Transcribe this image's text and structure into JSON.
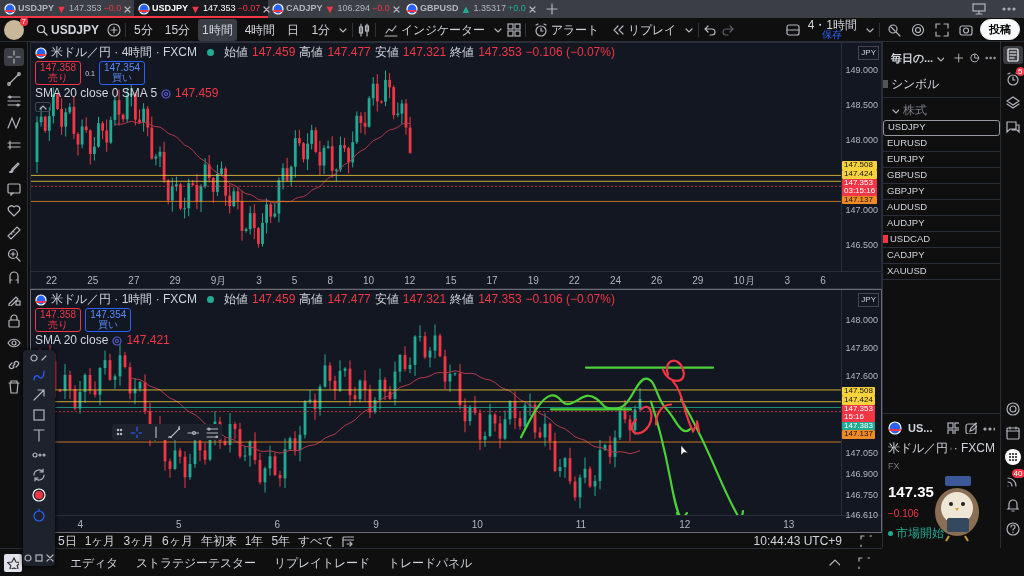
{
  "tabs": [
    {
      "symbol": "USDJPY",
      "arrow": "▼",
      "color": "#f23645",
      "price": "147.353",
      "change": "−0.0",
      "selected": false
    },
    {
      "symbol": "USDJPY",
      "arrow": "▼",
      "color": "#f23645",
      "price": "147.353",
      "change": "−0.07",
      "selected": true
    },
    {
      "symbol": "CADJPY",
      "arrow": "▼",
      "color": "#f23645",
      "price": "106.294",
      "change": "−0.0",
      "selected": false
    },
    {
      "symbol": "GBPUSD",
      "arrow": "▲",
      "color": "#22ab94",
      "price": "1.35317",
      "change": "+0.0",
      "selected": false
    }
  ],
  "toolbar": {
    "badge": "7",
    "symbol": "USDJPY",
    "intervals": [
      {
        "label": "5分",
        "selected": false
      },
      {
        "label": "15分",
        "selected": false
      },
      {
        "label": "1時間",
        "selected": true
      },
      {
        "label": "4時間",
        "selected": false
      },
      {
        "label": "日",
        "selected": false
      },
      {
        "label": "1分",
        "selected": false
      }
    ],
    "indicators": "インジケーター",
    "alert": "アラート",
    "replay": "リプレイ",
    "layout": "4・1時間",
    "layout_status": "保存",
    "post": "投稿"
  },
  "charts": [
    {
      "title": "米ドル／円 · 4時間 · FXCM",
      "ohlc": [
        {
          "label": "始値",
          "value": "147.459"
        },
        {
          "label": "高値",
          "value": "147.477"
        },
        {
          "label": "安値",
          "value": "147.321"
        },
        {
          "label": "終値",
          "value": "147.353"
        }
      ],
      "change": "−0.106 (−0.07%)",
      "sell": {
        "price": "147.358",
        "label": "売り"
      },
      "spread": "0.1",
      "buy": {
        "price": "147.354",
        "label": "買い"
      },
      "sma": "SMA 20 close 0 SMA 5",
      "sma_value": "147.459",
      "currency": "JPY",
      "price_ticks": [
        "149.000",
        "148.500",
        "148.000",
        "147.000",
        "146.500"
      ],
      "price_tags": [
        {
          "value": "147.508",
          "color": "#f7d23c"
        },
        {
          "value": "147.424",
          "color": "#f7d23c"
        },
        {
          "value": "147.353",
          "color": "#f23645",
          "sub": "03:15:16"
        },
        {
          "value": "147.137",
          "color": "#f08a24"
        }
      ],
      "time_ticks": [
        "22",
        "25",
        "27",
        "29",
        "9月",
        "3",
        "5",
        "8",
        "10",
        "12",
        "15",
        "17",
        "19",
        "22",
        "24",
        "26",
        "29",
        "10月",
        "3",
        "6"
      ]
    },
    {
      "title": "米ドル／円 · 1時間 · FXCM",
      "ohlc": [
        {
          "label": "始値",
          "value": "147.459"
        },
        {
          "label": "高値",
          "value": "147.477"
        },
        {
          "label": "安値",
          "value": "147.321"
        },
        {
          "label": "終値",
          "value": "147.353"
        }
      ],
      "change": "−0.106 (−0.07%)",
      "sell": {
        "price": "147.358",
        "label": "売り"
      },
      "buy": {
        "price": "147.354",
        "label": "買い"
      },
      "sma": "SMA 20 close",
      "sma_value": "147.421",
      "currency": "JPY",
      "price_ticks": [
        "148.000",
        "147.800",
        "147.600",
        "147.050",
        "146.900",
        "146.750",
        "146.610"
      ],
      "price_tags": [
        {
          "value": "147.508",
          "color": "#f7d23c"
        },
        {
          "value": "147.424",
          "color": "#f7d23c"
        },
        {
          "value": "147.353",
          "color": "#f23645",
          "sub": "15:16"
        },
        {
          "value": "147.383",
          "color": "#22ab94"
        },
        {
          "value": "147.137",
          "color": "#f08a24"
        }
      ],
      "time_ticks": [
        "4",
        "5",
        "6",
        "9",
        "10",
        "11",
        "12",
        "13"
      ]
    }
  ],
  "range_bar": {
    "ranges": [
      "5日",
      "1ヶ月",
      "3ヶ月",
      "6ヶ月",
      "年初来",
      "1年",
      "5年",
      "すべて"
    ],
    "time": "10:44:43 UTC+9"
  },
  "bottom_tabs": [
    "エディタ",
    "ストラテジーテスター",
    "リプレイトレード",
    "トレードパネル"
  ],
  "watchlist": {
    "title": "毎日の...",
    "column": "シンボル",
    "section": "株式",
    "items": [
      {
        "symbol": "USDJPY",
        "selected": true,
        "flagged": false
      },
      {
        "symbol": "EURUSD",
        "selected": false,
        "flagged": false
      },
      {
        "symbol": "EURJPY",
        "selected": false,
        "flagged": false
      },
      {
        "symbol": "GBPUSD",
        "selected": false,
        "flagged": false
      },
      {
        "symbol": "GBPJPY",
        "selected": false,
        "flagged": false
      },
      {
        "symbol": "AUDUSD",
        "selected": false,
        "flagged": false
      },
      {
        "symbol": "AUDJPY",
        "selected": false,
        "flagged": false
      },
      {
        "symbol": "USDCAD",
        "selected": false,
        "flagged": true
      },
      {
        "symbol": "CADJPY",
        "selected": false,
        "flagged": false
      },
      {
        "symbol": "XAUUSD",
        "selected": false,
        "flagged": false
      }
    ]
  },
  "details": {
    "symbol": "US...",
    "name": "米ドル／円",
    "exchange": "· FXCM",
    "type": "FX",
    "price": "147.35",
    "change": "−0.106",
    "status": "市場開始"
  },
  "sidebar_badges": {
    "alerts": "5",
    "news": "40"
  }
}
